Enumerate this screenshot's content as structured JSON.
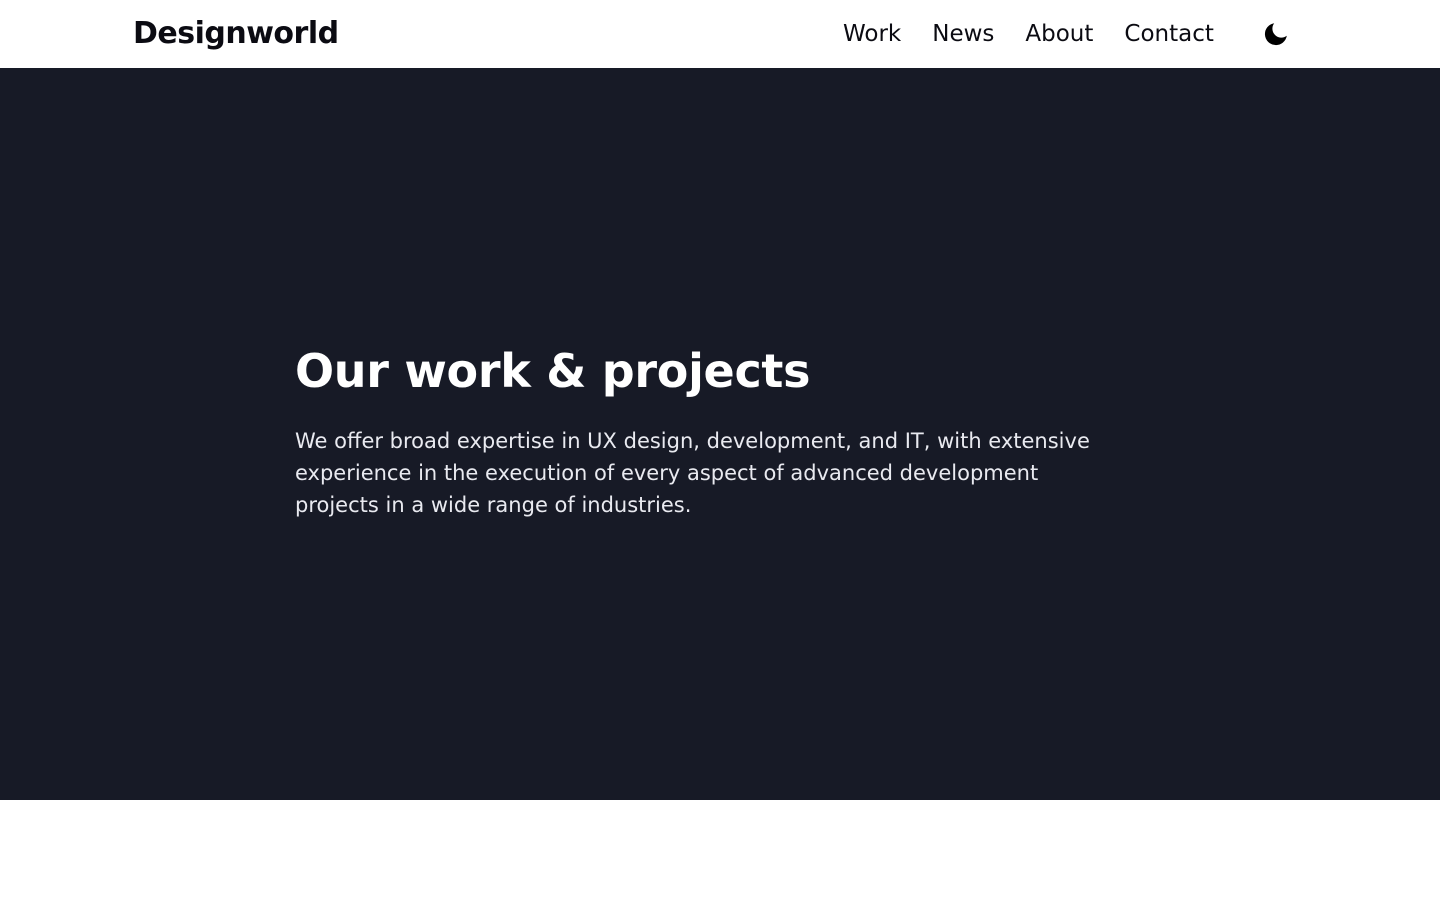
{
  "header": {
    "logo": "Designworld",
    "nav": [
      {
        "label": "Work"
      },
      {
        "label": "News"
      },
      {
        "label": "About"
      },
      {
        "label": "Contact"
      }
    ],
    "theme_toggle_icon": "moon-icon"
  },
  "hero": {
    "title": "Our work & projects",
    "description": "We offer broad expertise in UX design, development, and IT, with extensive experience in the execution of every aspect of advanced development projects in a wide range of industries."
  },
  "colors": {
    "hero_background": "#171a26",
    "header_background": "#ffffff",
    "text_dark": "#0b0b12",
    "text_light": "#ffffff"
  }
}
